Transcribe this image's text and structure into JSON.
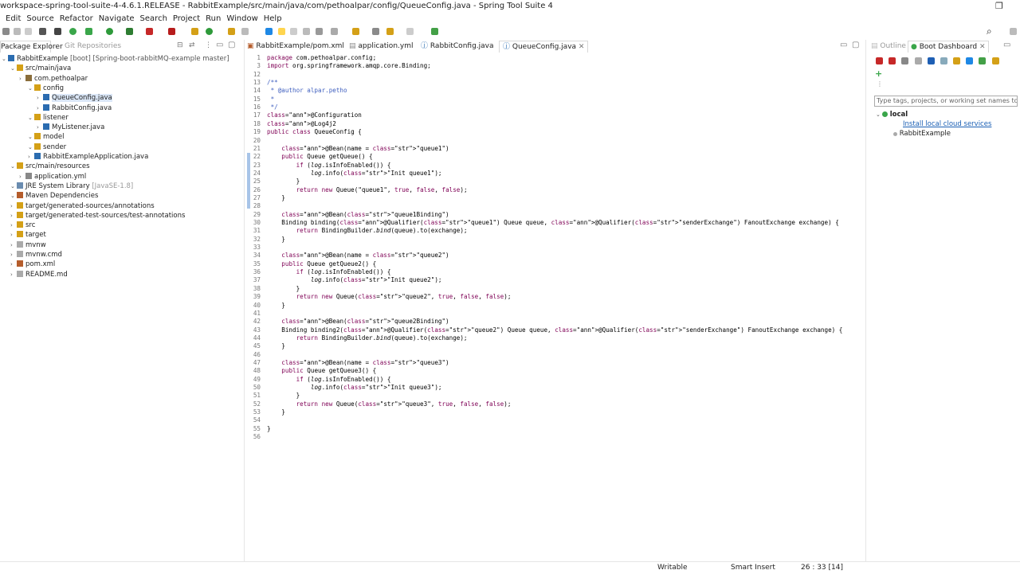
{
  "window": {
    "title": "workspace-spring-tool-suite-4-4.6.1.RELEASE - RabbitExample/src/main/java/com/pethoalpar/config/QueueConfig.java - Spring Tool Suite 4"
  },
  "menu": [
    "Edit",
    "Source",
    "Refactor",
    "Navigate",
    "Search",
    "Project",
    "Run",
    "Window",
    "Help"
  ],
  "left_tabs": {
    "package_explorer": "Package Explorer",
    "git_repositories": "Git Repositories"
  },
  "editor_tabs": [
    "RabbitExample/pom.xml",
    "application.yml",
    "RabbitConfig.java",
    "QueueConfig.java"
  ],
  "tree": [
    {
      "label": "RabbitExample",
      "suffix": "[boot] [Spring-boot-rabbitMQ-example master]",
      "indent": 0
    },
    {
      "label": "src/main/java",
      "indent": 1
    },
    {
      "label": "com.pethoalpar",
      "indent": 2
    },
    {
      "label": "config",
      "indent": 3
    },
    {
      "label": "QueueConfig.java",
      "indent": 4,
      "selected": true
    },
    {
      "label": "RabbitConfig.java",
      "indent": 4
    },
    {
      "label": "listener",
      "indent": 3
    },
    {
      "label": "MyListener.java",
      "indent": 4
    },
    {
      "label": "model",
      "indent": 3
    },
    {
      "label": "sender",
      "indent": 3
    },
    {
      "label": "RabbitExampleApplication.java",
      "indent": 3
    },
    {
      "label": "src/main/resources",
      "indent": 1
    },
    {
      "label": "application.yml",
      "indent": 2
    },
    {
      "label": "JRE System Library",
      "suffix": "[JavaSE-1.8]",
      "indent": 1
    },
    {
      "label": "Maven Dependencies",
      "indent": 1
    },
    {
      "label": "target/generated-sources/annotations",
      "indent": 1
    },
    {
      "label": "target/generated-test-sources/test-annotations",
      "indent": 1
    },
    {
      "label": "src",
      "indent": 1
    },
    {
      "label": "target",
      "indent": 1
    },
    {
      "label": "mvnw",
      "indent": 1
    },
    {
      "label": "mvnw.cmd",
      "indent": 1
    },
    {
      "label": "pom.xml",
      "indent": 1
    },
    {
      "label": "README.md",
      "indent": 1
    }
  ],
  "code": [
    {
      "n": "1",
      "t": "package com.pethoalpar.config;"
    },
    {
      "n": "3",
      "t": "import org.springframework.amqp.core.Binding;"
    },
    {
      "n": "12",
      "t": ""
    },
    {
      "n": "13",
      "t": "/**"
    },
    {
      "n": "14",
      "t": " * @author alpar.petho"
    },
    {
      "n": "15",
      "t": " *"
    },
    {
      "n": "16",
      "t": " */"
    },
    {
      "n": "17",
      "t": "@Configuration"
    },
    {
      "n": "18",
      "t": "@Log4j2"
    },
    {
      "n": "19",
      "t": "public class QueueConfig {"
    },
    {
      "n": "20",
      "t": ""
    },
    {
      "n": "21",
      "t": "    @Bean(name = \"queue1\")"
    },
    {
      "n": "22",
      "t": "    public Queue getQueue() {"
    },
    {
      "n": "23",
      "t": "        if (log.isInfoEnabled()) {"
    },
    {
      "n": "24",
      "t": "            log.info(\"Init queue1\");"
    },
    {
      "n": "25",
      "t": "        }"
    },
    {
      "n": "26",
      "t": "        return new Queue(\"queue1\", true, false, false);"
    },
    {
      "n": "27",
      "t": "    }"
    },
    {
      "n": "28",
      "t": ""
    },
    {
      "n": "29",
      "t": "    @Bean(\"queue1Binding\")"
    },
    {
      "n": "30",
      "t": "    Binding binding(@Qualifier(\"queue1\") Queue queue, @Qualifier(\"senderExchange\") FanoutExchange exchange) {"
    },
    {
      "n": "31",
      "t": "        return BindingBuilder.bind(queue).to(exchange);"
    },
    {
      "n": "32",
      "t": "    }"
    },
    {
      "n": "33",
      "t": ""
    },
    {
      "n": "34",
      "t": "    @Bean(name = \"queue2\")"
    },
    {
      "n": "35",
      "t": "    public Queue getQueue2() {"
    },
    {
      "n": "36",
      "t": "        if (log.isInfoEnabled()) {"
    },
    {
      "n": "37",
      "t": "            log.info(\"Init queue2\");"
    },
    {
      "n": "38",
      "t": "        }"
    },
    {
      "n": "39",
      "t": "        return new Queue(\"queue2\", true, false, false);"
    },
    {
      "n": "40",
      "t": "    }"
    },
    {
      "n": "41",
      "t": ""
    },
    {
      "n": "42",
      "t": "    @Bean(\"queue2Binding\")"
    },
    {
      "n": "43",
      "t": "    Binding binding2(@Qualifier(\"queue2\") Queue queue, @Qualifier(\"senderExchange\") FanoutExchange exchange) {"
    },
    {
      "n": "44",
      "t": "        return BindingBuilder.bind(queue).to(exchange);"
    },
    {
      "n": "45",
      "t": "    }"
    },
    {
      "n": "46",
      "t": ""
    },
    {
      "n": "47",
      "t": "    @Bean(name = \"queue3\")"
    },
    {
      "n": "48",
      "t": "    public Queue getQueue3() {"
    },
    {
      "n": "49",
      "t": "        if (log.isInfoEnabled()) {"
    },
    {
      "n": "50",
      "t": "            log.info(\"Init queue3\");"
    },
    {
      "n": "51",
      "t": "        }"
    },
    {
      "n": "52",
      "t": "        return new Queue(\"queue3\", true, false, false);"
    },
    {
      "n": "53",
      "t": "    }"
    },
    {
      "n": "54",
      "t": ""
    },
    {
      "n": "55",
      "t": "}"
    },
    {
      "n": "56",
      "t": ""
    }
  ],
  "right_tabs": {
    "outline": "Outline",
    "boot_dashboard": "Boot Dashboard"
  },
  "boot_dashboard": {
    "search_placeholder": "Type tags, projects, or working set names to ma",
    "local_label": "local",
    "install_link": "Install local cloud services",
    "app_label": "RabbitExample"
  },
  "status": {
    "writable": "Writable",
    "insert_mode": "Smart Insert",
    "position": "26 : 33 [14]"
  },
  "colors": {
    "selection": "#3875d7",
    "keyword": "#7f0055",
    "string": "#2a00ff",
    "accent_green": "#3aa64a"
  }
}
